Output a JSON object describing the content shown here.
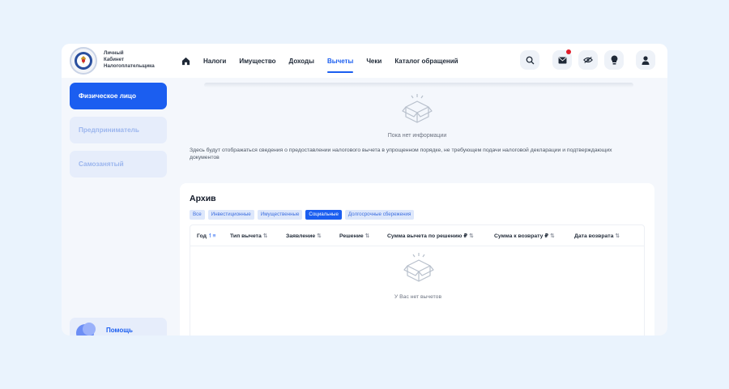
{
  "brand": {
    "line1": "Личный",
    "line2": "Кабинет",
    "line3": "Налогоплательщика"
  },
  "nav": [
    "Налоги",
    "Имущество",
    "Доходы",
    "Вычеты",
    "Чеки",
    "Каталог обращений"
  ],
  "nav_active_index": 3,
  "header_icons": [
    "search-icon",
    "mail-icon",
    "eye-off-icon",
    "lightbulb-icon",
    "user-icon"
  ],
  "sidebar": {
    "items": [
      "Физическое лицо",
      "Предприниматель",
      "Самозанятый"
    ],
    "help": "Помощь"
  },
  "top": {
    "empty_text": "Пока нет информации",
    "description": "Здесь будут отображаться сведения о предоставлении налогового вычета в упрощенном порядке, не требующем подачи налоговой декларации и подтверждающих документов"
  },
  "archive": {
    "title": "Архив",
    "filters": [
      "Все",
      "Инвестиционные",
      "Имущественные",
      "Социальные",
      "Долгосрочные сбережения"
    ],
    "active_filter_index": 3,
    "columns": [
      "Год",
      "Тип вычета",
      "Заявление",
      "Решение",
      "Сумма вычета по решению ₽",
      "Сумма к возврату ₽",
      "Дата возврата"
    ],
    "empty_text": "У Вас нет вычетов"
  },
  "colors": {
    "accent": "#1b5ef0",
    "notification": "#e11d2a",
    "background": "#eaf3fd"
  }
}
